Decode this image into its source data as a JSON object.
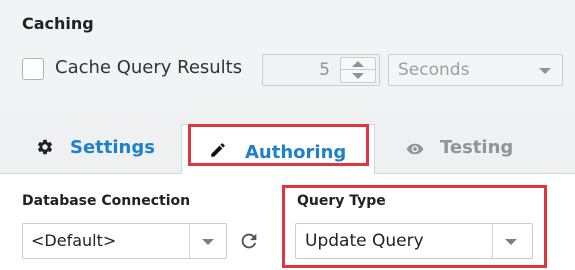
{
  "caching": {
    "title": "Caching",
    "cache_checkbox": {
      "label": "Cache Query Results",
      "checked": false
    },
    "duration": {
      "value": "5"
    },
    "units": {
      "selected": "Seconds"
    }
  },
  "tabs": [
    {
      "label": "Settings",
      "icon": "gear-icon",
      "active": false
    },
    {
      "label": "Authoring",
      "icon": "pencil-icon",
      "active": true
    },
    {
      "label": "Testing",
      "icon": "eye-icon",
      "active": false
    }
  ],
  "authoring": {
    "database_connection": {
      "label": "Database Connection",
      "selected": "<Default>"
    },
    "query_type": {
      "label": "Query Type",
      "selected": "Update Query"
    }
  },
  "colors": {
    "accent": "#1e81c9",
    "highlight": "#e0373f",
    "inactive_tab": "#8f9499"
  }
}
